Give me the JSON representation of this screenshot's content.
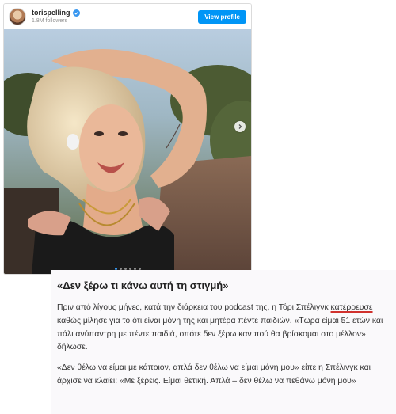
{
  "embed": {
    "username": "torispelling",
    "followers": "1.8M followers",
    "view_profile_label": "View profile",
    "carousel_dots": 6,
    "active_dot": 0
  },
  "article": {
    "heading": "«Δεν ξέρω τι κάνω αυτή τη στιγμή»",
    "p1_before": "Πριν από λίγους μήνες, κατά την διάρκεια του podcast της, η Τόρι Σπέλιγνκ ",
    "p1_link": "κατέρρευσε",
    "p1_after": " καθώς μίλησε για το ότι είναι μόνη της και μητέρα πέντε παιδιών. «Τώρα είμαι 51 ετών και πάλι ανύπαντρη με πέντε παιδιά, οπότε δεν ξέρω καν πού θα βρίσκομαι στο μέλλον» δήλωσε.",
    "p2": "«Δεν θέλω να είμαι με κάποιον, απλά δεν θέλω να είμαι μόνη μου» είπε η Σπέλινγκ και άρχισε να κλαίει: «Με ξέρεις. Είμαι θετική. Απλά – δεν θέλω να πεθάνω μόνη μου»"
  },
  "colors": {
    "instagram_blue": "#0095f6",
    "underline_red": "#d0312d"
  }
}
